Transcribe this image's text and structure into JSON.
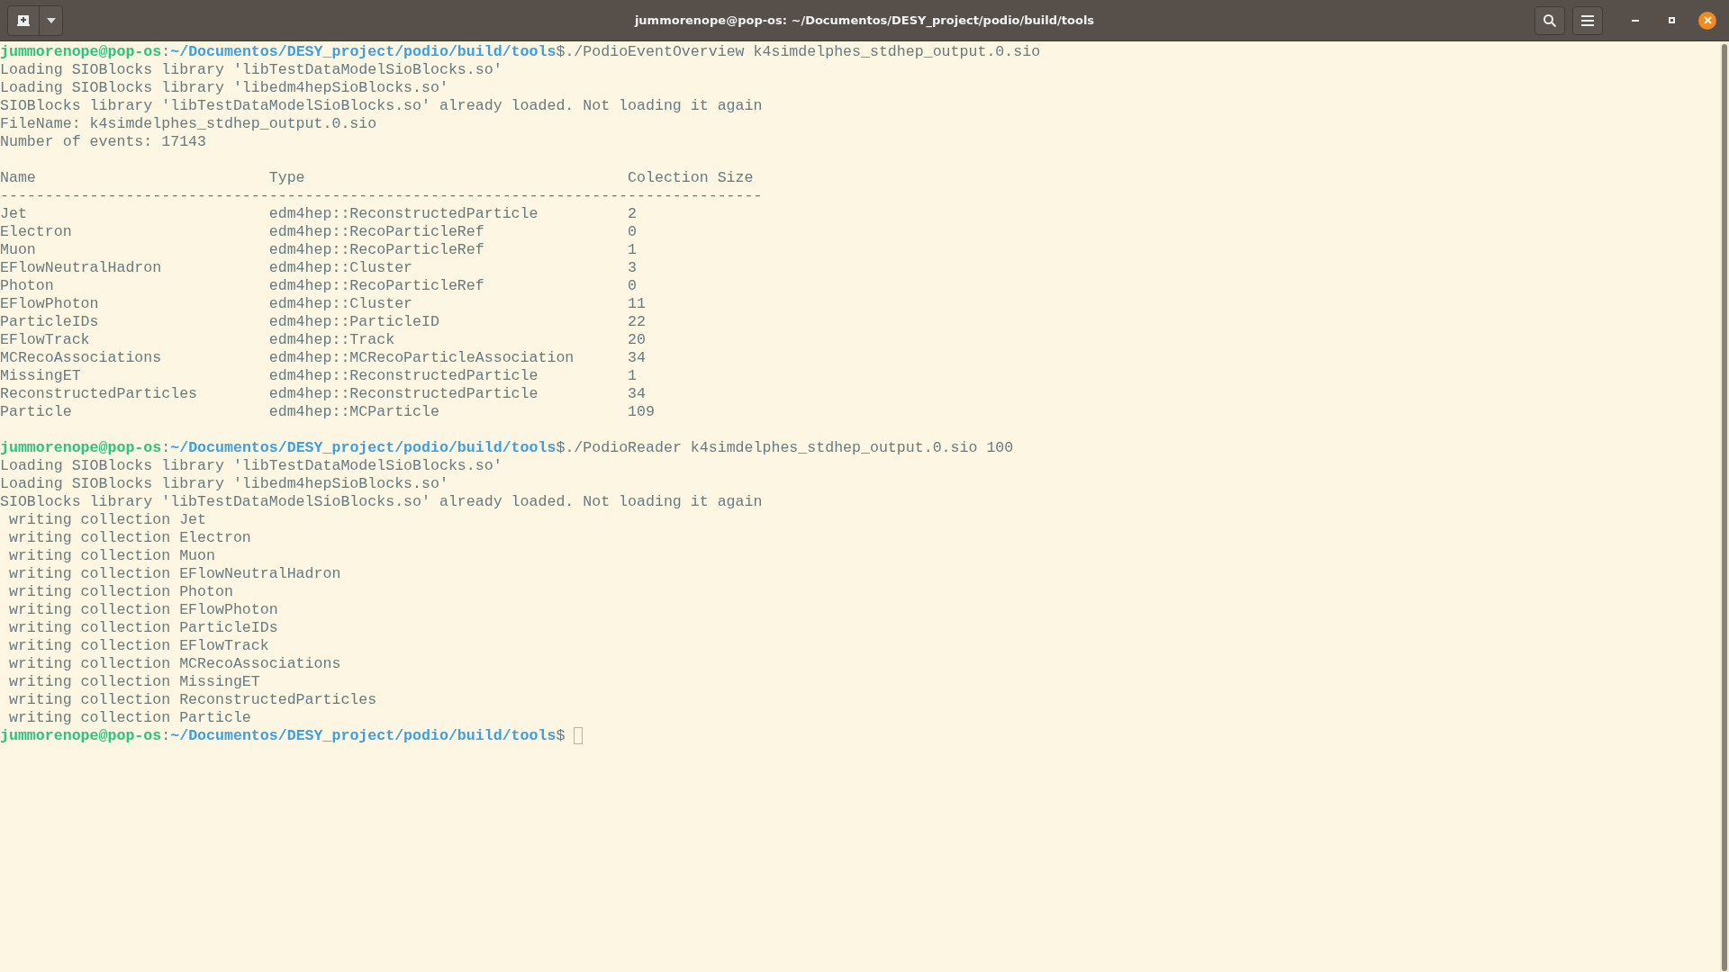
{
  "window": {
    "title": "jummorenope@pop-os: ~/Documentos/DESY_project/podio/build/tools"
  },
  "lines": [
    {
      "kind": "prompt",
      "user_host": "jummorenope@pop-os",
      "separator": ":",
      "path": "~/Documentos/DESY_project/podio/build/tools",
      "symbol": "$",
      "command": "./PodioEventOverview k4simdelphes_stdhep_output.0.sio"
    },
    {
      "kind": "output",
      "text": "Loading SIOBlocks library 'libTestDataModelSioBlocks.so'"
    },
    {
      "kind": "output",
      "text": "Loading SIOBlocks library 'libedm4hepSioBlocks.so'"
    },
    {
      "kind": "output",
      "text": "SIOBlocks library 'libTestDataModelSioBlocks.so' already loaded. Not loading it again"
    },
    {
      "kind": "output",
      "text": "FileName: k4simdelphes_stdhep_output.0.sio"
    },
    {
      "kind": "output",
      "text": "Number of events: 17143"
    },
    {
      "kind": "blank"
    },
    {
      "kind": "table",
      "columns": [
        "Name",
        "Type",
        "Colection Size"
      ],
      "rule": "-------------------------------------------------------------------------------------",
      "rows": [
        [
          "Jet",
          "edm4hep::ReconstructedParticle",
          "2"
        ],
        [
          "Electron",
          "edm4hep::RecoParticleRef",
          "0"
        ],
        [
          "Muon",
          "edm4hep::RecoParticleRef",
          "1"
        ],
        [
          "EFlowNeutralHadron",
          "edm4hep::Cluster",
          "3"
        ],
        [
          "Photon",
          "edm4hep::RecoParticleRef",
          "0"
        ],
        [
          "EFlowPhoton",
          "edm4hep::Cluster",
          "11"
        ],
        [
          "ParticleIDs",
          "edm4hep::ParticleID",
          "22"
        ],
        [
          "EFlowTrack",
          "edm4hep::Track",
          "20"
        ],
        [
          "MCRecoAssociations",
          "edm4hep::MCRecoParticleAssociation",
          "34"
        ],
        [
          "MissingET",
          "edm4hep::ReconstructedParticle",
          "1"
        ],
        [
          "ReconstructedParticles",
          "edm4hep::ReconstructedParticle",
          "34"
        ],
        [
          "Particle",
          "edm4hep::MCParticle",
          "109"
        ]
      ]
    },
    {
      "kind": "blank"
    },
    {
      "kind": "prompt",
      "user_host": "jummorenope@pop-os",
      "separator": ":",
      "path": "~/Documentos/DESY_project/podio/build/tools",
      "symbol": "$",
      "command": "./PodioReader k4simdelphes_stdhep_output.0.sio 100"
    },
    {
      "kind": "output",
      "text": "Loading SIOBlocks library 'libTestDataModelSioBlocks.so'"
    },
    {
      "kind": "output",
      "text": "Loading SIOBlocks library 'libedm4hepSioBlocks.so'"
    },
    {
      "kind": "output",
      "text": "SIOBlocks library 'libTestDataModelSioBlocks.so' already loaded. Not loading it again"
    },
    {
      "kind": "output",
      "text": " writing collection Jet"
    },
    {
      "kind": "output",
      "text": " writing collection Electron"
    },
    {
      "kind": "output",
      "text": " writing collection Muon"
    },
    {
      "kind": "output",
      "text": " writing collection EFlowNeutralHadron"
    },
    {
      "kind": "output",
      "text": " writing collection Photon"
    },
    {
      "kind": "output",
      "text": " writing collection EFlowPhoton"
    },
    {
      "kind": "output",
      "text": " writing collection ParticleIDs"
    },
    {
      "kind": "output",
      "text": " writing collection EFlowTrack"
    },
    {
      "kind": "output",
      "text": " writing collection MCRecoAssociations"
    },
    {
      "kind": "output",
      "text": " writing collection MissingET"
    },
    {
      "kind": "output",
      "text": " writing collection ReconstructedParticles"
    },
    {
      "kind": "output",
      "text": " writing collection Particle"
    },
    {
      "kind": "prompt",
      "user_host": "jummorenope@pop-os",
      "separator": ":",
      "path": "~/Documentos/DESY_project/podio/build/tools",
      "symbol": "$",
      "cursor": true
    }
  ]
}
